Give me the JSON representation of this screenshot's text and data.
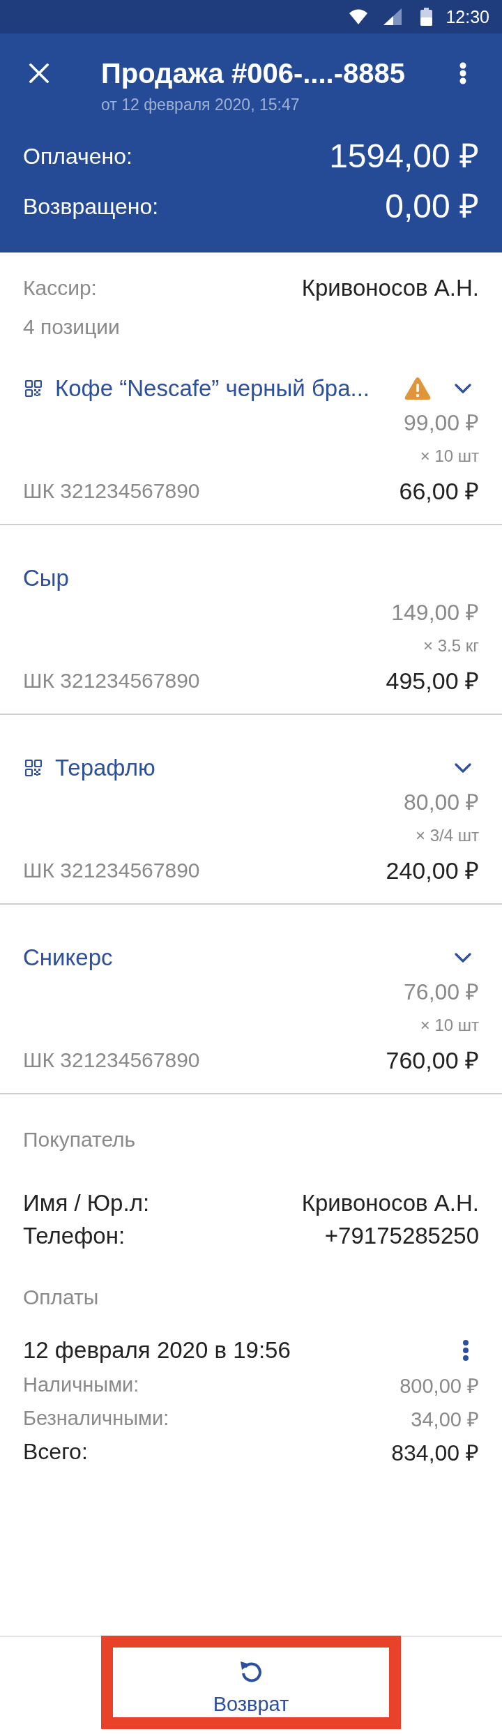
{
  "status_bar": {
    "time": "12:30"
  },
  "header": {
    "title": "Продажа #006-....-8885",
    "subtitle": "от 12 февраля 2020, 15:47",
    "totals": [
      {
        "label": "Оплачено:",
        "value": "1594,00 ₽"
      },
      {
        "label": "Возвращено:",
        "value": "0,00 ₽"
      }
    ]
  },
  "summary": {
    "cashier_label": "Кассир:",
    "cashier": "Кривоносов А.Н.",
    "positions_count": "4 позиции"
  },
  "items": [
    {
      "name": "Кофе “Nescafe” черный бра...",
      "qr_code": true,
      "warning": true,
      "expandable": true,
      "price": "99,00 ₽",
      "quantity": "× 10 шт",
      "barcode": "ШК 321234567890",
      "total": "66,00 ₽"
    },
    {
      "name": "Сыр",
      "qr_code": false,
      "warning": false,
      "expandable": false,
      "price": "149,00 ₽",
      "quantity": "× 3.5 кг",
      "barcode": "ШК 321234567890",
      "total": "495,00 ₽"
    },
    {
      "name": "Терафлю",
      "qr_code": true,
      "warning": false,
      "expandable": true,
      "price": "80,00 ₽",
      "quantity": "× 3/4 шт",
      "barcode": "ШК 321234567890",
      "total": "240,00 ₽"
    },
    {
      "name": "Сникерс",
      "qr_code": false,
      "warning": false,
      "expandable": true,
      "price": "76,00 ₽",
      "quantity": "× 10 шт",
      "barcode": "ШК 321234567890",
      "total": "760,00 ₽"
    }
  ],
  "buyer": {
    "title": "Покупатель",
    "fields": [
      {
        "label": "Имя / Юр.л:",
        "value": "Кривоносов А.Н."
      },
      {
        "label": "Телефон:",
        "value": "+79175285250"
      }
    ]
  },
  "payments": {
    "title": "Оплаты",
    "entries": [
      {
        "date": "12 февраля 2020 в 19:56",
        "lines": [
          {
            "kind": "detail",
            "label": "Наличными:",
            "value": "800,00 ₽"
          },
          {
            "kind": "detail",
            "label": "Безналичными:",
            "value": "34,00 ₽"
          },
          {
            "kind": "total",
            "label": "Всего:",
            "value": "834,00 ₽"
          }
        ]
      }
    ]
  },
  "bottom_bar": {
    "return_button": {
      "label": "Возврат",
      "highlighted": true
    }
  }
}
